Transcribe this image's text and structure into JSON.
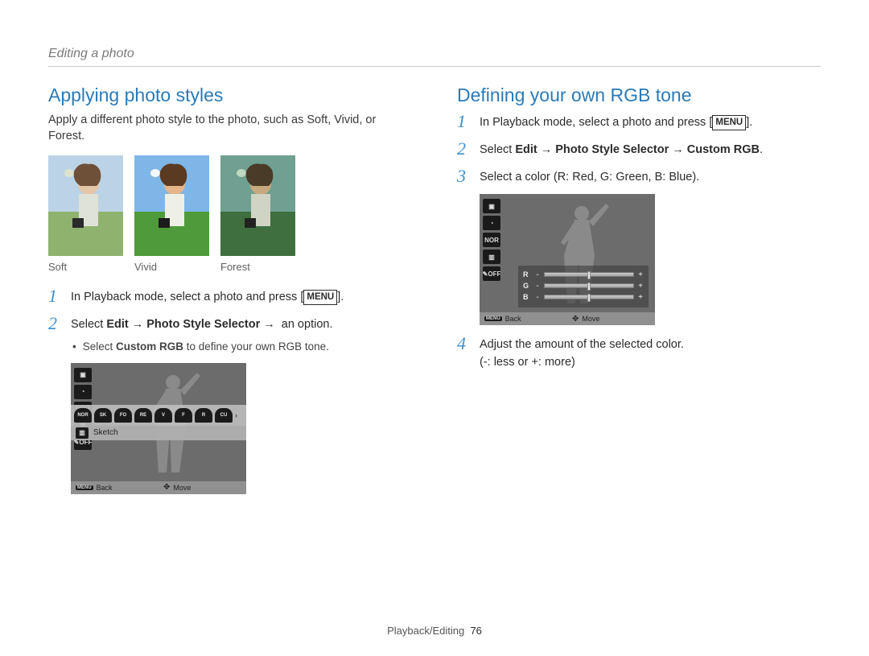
{
  "breadcrumb": "Editing a photo",
  "left": {
    "heading": "Applying photo styles",
    "intro": "Apply a different photo style to the photo, such as Soft, Vivid, or Forest.",
    "thumb_labels": [
      "Soft",
      "Vivid",
      "Forest"
    ],
    "steps": {
      "s1_pre": "In Playback mode, select a photo and press [",
      "s1_menu": "MENU",
      "s1_post": "].",
      "s2_pre": "Select ",
      "s2_edit": "Edit",
      "s2_pss": "Photo Style Selector",
      "s2_post": " an option.",
      "s2_sub_pre": "Select ",
      "s2_sub_bold": "Custom RGB",
      "s2_sub_post": " to define your own RGB tone."
    },
    "lcd": {
      "left_icons": [
        "▣",
        "◔",
        "NOR",
        "▥",
        "✎OFF"
      ],
      "style_icons": [
        "NOR",
        "SK",
        "FO",
        "RE",
        "V",
        "F",
        "R",
        "CU",
        "›"
      ],
      "style_label_icon": "▥",
      "style_label": "Sketch",
      "footer_back": "Back",
      "footer_move": "Move",
      "menu_mini": "MENU"
    }
  },
  "right": {
    "heading": "Defining your own RGB tone",
    "steps": {
      "s1_pre": "In Playback mode, select a photo and press [",
      "s1_menu": "MENU",
      "s1_post": "].",
      "s2_pre": "Select ",
      "s2_edit": "Edit",
      "s2_pss": "Photo Style Selector",
      "s2_custom": "Custom RGB",
      "s2_period": ".",
      "s3": "Select a color (R: Red, G: Green, B: Blue).",
      "s4_a": "Adjust the amount of the selected color.",
      "s4_b": "(-: less or +: more)"
    },
    "lcd": {
      "left_icons": [
        "▣",
        "◔",
        "NOR",
        "▥",
        "✎OFF"
      ],
      "sliders": [
        {
          "label": "R",
          "minus": "-",
          "plus": "+"
        },
        {
          "label": "G",
          "minus": "-",
          "plus": "+"
        },
        {
          "label": "B",
          "minus": "-",
          "plus": "+"
        }
      ],
      "footer_back": "Back",
      "footer_move": "Move",
      "menu_mini": "MENU"
    }
  },
  "footer": {
    "section": "Playback/Editing",
    "page": "76"
  }
}
